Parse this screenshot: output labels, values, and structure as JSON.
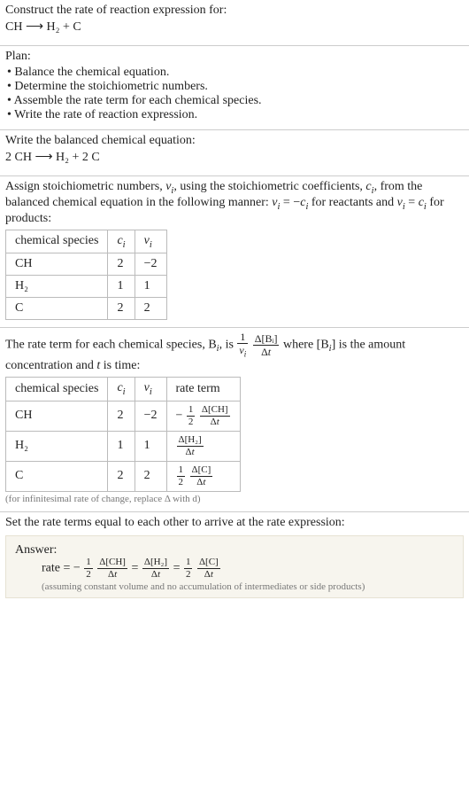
{
  "s1": {
    "heading": "Construct the rate of reaction expression for:",
    "eq": "CH ⟶ H₂ + C"
  },
  "s2": {
    "heading": "Plan:",
    "items": [
      "Balance the chemical equation.",
      "Determine the stoichiometric numbers.",
      "Assemble the rate term for each chemical species.",
      "Write the rate of reaction expression."
    ]
  },
  "s3": {
    "heading": "Write the balanced chemical equation:",
    "eq": "2 CH ⟶ H₂ + 2 C"
  },
  "s4": {
    "intro1": "Assign stoichiometric numbers, ",
    "nu": "ν",
    "sub_i": "i",
    "intro2": ", using the stoichiometric coefficients, ",
    "c": "c",
    "intro3": ", from the balanced chemical equation in the following manner: ",
    "rel1a": "ν",
    "rel1b": " = −",
    "rel1c": "c",
    "rel1d": " for reactants and ",
    "rel2a": "ν",
    "rel2b": " = ",
    "rel2c": "c",
    "rel2d": " for products:",
    "headers": {
      "species": "chemical species",
      "ci": "cᵢ",
      "nui": "νᵢ"
    },
    "rows": [
      {
        "name": "CH",
        "ci": "2",
        "nui": "−2"
      },
      {
        "name": "H₂",
        "ci": "1",
        "nui": "1"
      },
      {
        "name": "C",
        "ci": "2",
        "nui": "2"
      }
    ]
  },
  "s5": {
    "intro_a": "The rate term for each chemical species, B",
    "intro_b": ", is ",
    "frac1_num": "1",
    "frac1_den": "νᵢ",
    "frac2_num": "Δ[Bᵢ]",
    "frac2_den": "Δt",
    "intro_c": " where [B",
    "intro_d": "] is the amount concentration and ",
    "t": "t",
    "intro_e": " is time:",
    "headers": {
      "species": "chemical species",
      "ci": "cᵢ",
      "nui": "νᵢ",
      "rate": "rate term"
    },
    "rows": [
      {
        "name": "CH",
        "ci": "2",
        "nui": "−2",
        "sign": "−",
        "coef_num": "1",
        "coef_den": "2",
        "dnum": "Δ[CH]",
        "dden": "Δt"
      },
      {
        "name": "H₂",
        "ci": "1",
        "nui": "1",
        "sign": "",
        "coef_num": "",
        "coef_den": "",
        "dnum": "Δ[H₂]",
        "dden": "Δt"
      },
      {
        "name": "C",
        "ci": "2",
        "nui": "2",
        "sign": "",
        "coef_num": "1",
        "coef_den": "2",
        "dnum": "Δ[C]",
        "dden": "Δt"
      }
    ],
    "footnote": "(for infinitesimal rate of change, replace Δ with d)"
  },
  "s6": {
    "heading": "Set the rate terms equal to each other to arrive at the rate expression:",
    "answer_label": "Answer:",
    "rate_label": "rate = ",
    "t1_sign": "−",
    "t1_num": "1",
    "t1_den": "2",
    "t1_dnum": "Δ[CH]",
    "t1_dden": "Δt",
    "eq": " = ",
    "t2_dnum": "Δ[H₂]",
    "t2_dden": "Δt",
    "t3_num": "1",
    "t3_den": "2",
    "t3_dnum": "Δ[C]",
    "t3_dden": "Δt",
    "assume": "(assuming constant volume and no accumulation of intermediates or side products)"
  },
  "chart_data": {
    "type": "table",
    "tables": [
      {
        "title": "stoichiometric numbers",
        "columns": [
          "chemical species",
          "c_i",
          "nu_i"
        ],
        "rows": [
          [
            "CH",
            2,
            -2
          ],
          [
            "H2",
            1,
            1
          ],
          [
            "C",
            2,
            2
          ]
        ]
      },
      {
        "title": "rate terms",
        "columns": [
          "chemical species",
          "c_i",
          "nu_i",
          "rate term"
        ],
        "rows": [
          [
            "CH",
            2,
            -2,
            "-(1/2) Δ[CH]/Δt"
          ],
          [
            "H2",
            1,
            1,
            "Δ[H2]/Δt"
          ],
          [
            "C",
            2,
            2,
            "(1/2) Δ[C]/Δt"
          ]
        ]
      }
    ],
    "rate_expression": "rate = -(1/2) Δ[CH]/Δt = Δ[H2]/Δt = (1/2) Δ[C]/Δt"
  }
}
